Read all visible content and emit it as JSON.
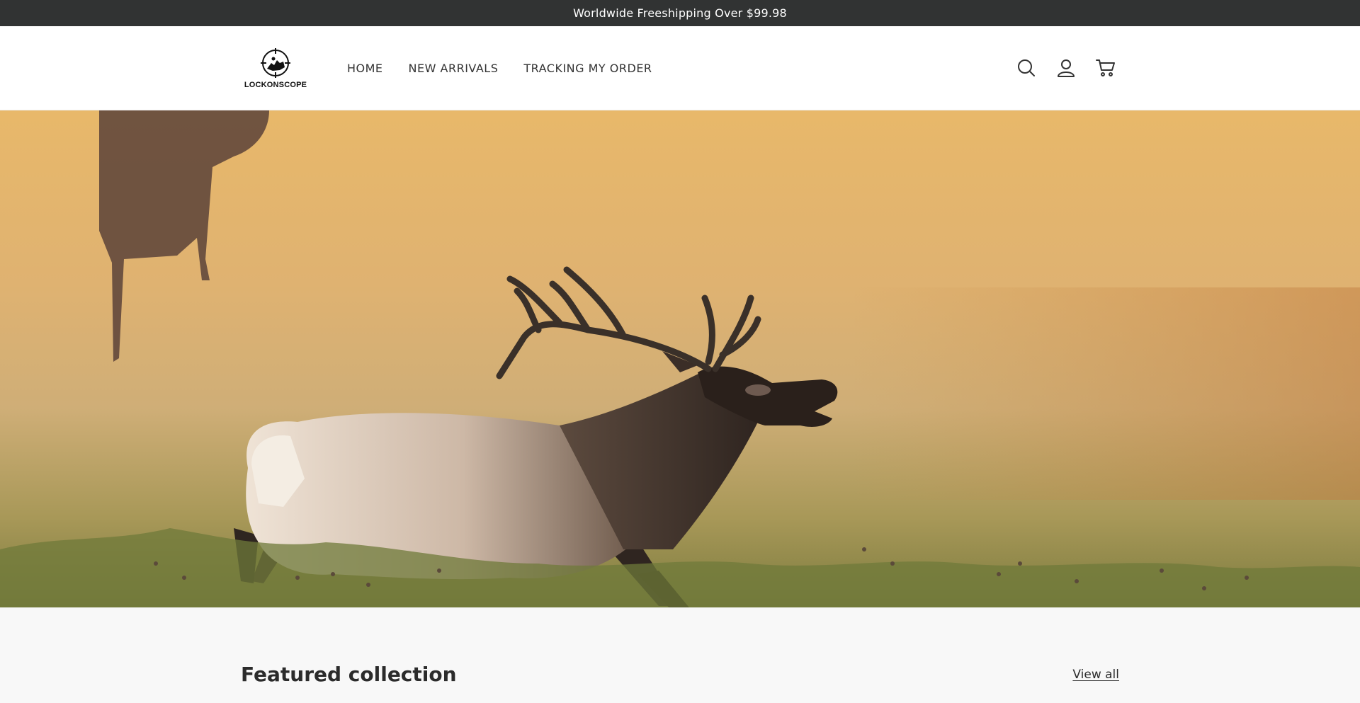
{
  "announcement": {
    "text": "Worldwide Freeshipping Over $99.98"
  },
  "header": {
    "logo_text": "LOCKONSCOPE",
    "nav": [
      {
        "label": "HOME"
      },
      {
        "label": "NEW ARRIVALS"
      },
      {
        "label": "TRACKING MY ORDER"
      }
    ],
    "icons": [
      "search-icon",
      "account-icon",
      "cart-icon"
    ]
  },
  "hero": {
    "image": "elk-in-golden-meadow"
  },
  "featured": {
    "title": "Featured collection",
    "view_all": "View all"
  },
  "colors": {
    "announcement_bg": "#313333",
    "header_bg": "#ffffff",
    "page_bg": "#f8f8f8",
    "text": "#2b2b2b"
  }
}
